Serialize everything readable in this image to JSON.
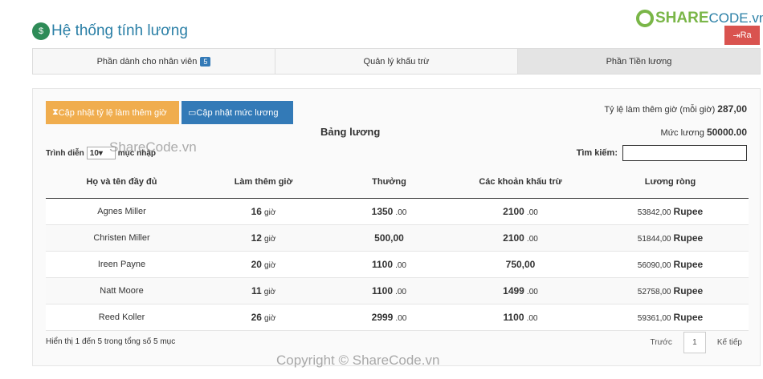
{
  "header": {
    "title": "Hệ thống tính lương",
    "brand_part1": "SHARE",
    "brand_part2": "CODE.vn",
    "logout_label": "Ra"
  },
  "tabs": [
    {
      "label": "Phần dành cho nhân viên",
      "badge": "5"
    },
    {
      "label": "Quản lý khấu trừ"
    },
    {
      "label": "Phần Tiền lương"
    }
  ],
  "actions": {
    "overtime_button": "Cập nhật tỷ lệ làm thêm giờ",
    "salary_button": "Cập nhật mức lương"
  },
  "rates": {
    "overtime_label": "Tỷ lệ làm thêm giờ (mỗi giờ)",
    "overtime_value": "287,00",
    "salary_label": "Mức lương",
    "salary_value": "50000.00"
  },
  "table": {
    "title": "Bảng lương",
    "length_prefix": "Trình diễn",
    "length_value": "10",
    "length_suffix": "mục nhập",
    "search_label": "Tìm kiếm:",
    "columns": [
      "Họ và tên đầy đủ",
      "Làm thêm giờ",
      "Thưởng",
      "Các khoản khấu trừ",
      "Lương ròng"
    ],
    "rows": [
      {
        "name": "Agnes Miller",
        "ot": "16",
        "ot_unit": "giờ",
        "bonus": "1350",
        "bonus_dec": ".00",
        "ded": "2100",
        "ded_dec": ".00",
        "net": "53842,00",
        "cur": "Rupee"
      },
      {
        "name": "Christen Miller",
        "ot": "12",
        "ot_unit": "giờ",
        "bonus": "500,00",
        "bonus_dec": "",
        "ded": "2100",
        "ded_dec": ".00",
        "net": "51844,00",
        "cur": "Rupee"
      },
      {
        "name": "Ireen Payne",
        "ot": "20",
        "ot_unit": "giờ",
        "bonus": "1100",
        "bonus_dec": ".00",
        "ded": "750,00",
        "ded_dec": "",
        "net": "56090,00",
        "cur": "Rupee"
      },
      {
        "name": "Natt Moore",
        "ot": "11",
        "ot_unit": "giờ",
        "bonus": "1100",
        "bonus_dec": ".00",
        "ded": "1499",
        "ded_dec": ".00",
        "net": "52758,00",
        "cur": "Rupee"
      },
      {
        "name": "Reed Koller",
        "ot": "26",
        "ot_unit": "giờ",
        "bonus": "2999",
        "bonus_dec": ".00",
        "ded": "1100",
        "ded_dec": ".00",
        "net": "59361,00",
        "cur": "Rupee"
      }
    ],
    "info": "Hiển thị 1 đến 5 trong tổng số 5 mục",
    "prev_label": "Trước",
    "page": "1",
    "next_label": "Kế tiếp"
  },
  "watermarks": {
    "footer": "Copyright © ShareCode.vn",
    "center": "ShareCode.vn"
  },
  "colors": {
    "title": "#2a7fa6",
    "warning": "#f0ad4e",
    "primary": "#337ab7",
    "danger": "#d9534f"
  }
}
